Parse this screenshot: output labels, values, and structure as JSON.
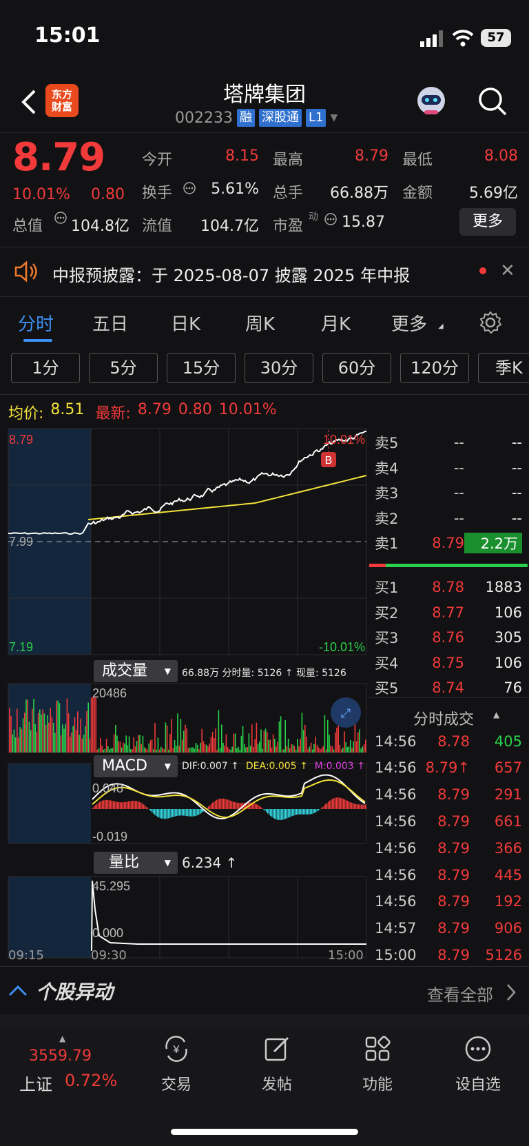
{
  "status": {
    "time": "15:01",
    "battery": "57"
  },
  "header": {
    "logo_line1": "东方",
    "logo_line2": "财富",
    "title": "塔牌集团",
    "code": "002233",
    "tags": [
      "融",
      "深股通",
      "L1"
    ]
  },
  "quote": {
    "price": "8.79",
    "change_pct": "10.01%",
    "change": "0.80",
    "open_label": "今开",
    "open": "8.15",
    "high_label": "最高",
    "high": "8.79",
    "low_label": "最低",
    "low": "8.08",
    "turnover_label": "换手",
    "turnover": "5.61%",
    "volume_label": "总手",
    "volume": "66.88万",
    "amount_label": "金额",
    "amount": "5.69亿",
    "mcap_label": "总值",
    "mcap": "104.8亿",
    "float_label": "流值",
    "float": "104.7亿",
    "pe_label": "市盈",
    "pe_sup": "动",
    "pe": "15.87",
    "more": "更多"
  },
  "notice": {
    "text": "中报预披露：于 2025-08-07 披露 2025 年中报"
  },
  "tabs": [
    "分时",
    "五日",
    "日K",
    "周K",
    "月K",
    "更多"
  ],
  "periods": [
    "1分",
    "5分",
    "15分",
    "30分",
    "60分",
    "120分",
    "季K"
  ],
  "chart_info": {
    "avg_label": "均价:",
    "avg": "8.51",
    "latest_label": "最新:",
    "latest": "8.79",
    "chg": "0.80",
    "pct": "10.01%"
  },
  "chart_data": {
    "type": "line",
    "y_top": "8.79",
    "y_mid": "7.99",
    "y_bottom": "7.19",
    "pct_top": "10.01%",
    "pct_bottom": "-10.01%",
    "x_labels": [
      "09:15",
      "09:30",
      "15:00"
    ],
    "marker": "B",
    "volume_title": "成交量",
    "volume_info": "66.88万 分时量: 5126 ↑ 现量: 5126",
    "volume_max": "20486",
    "macd_title": "MACD",
    "dif": "DIF:0.007 ↑",
    "dea": "DEA:0.005 ↑",
    "m": "M:0.003 ↑",
    "macd_top": "0.048",
    "macd_bottom": "-0.019",
    "lb_title": "量比",
    "lb_value": "6.234 ↑",
    "lb_top": "45.295",
    "lb_bottom": "0.000"
  },
  "order_book": {
    "asks": [
      {
        "label": "卖5",
        "price": "--",
        "vol": "--"
      },
      {
        "label": "卖4",
        "price": "--",
        "vol": "--"
      },
      {
        "label": "卖3",
        "price": "--",
        "vol": "--"
      },
      {
        "label": "卖2",
        "price": "--",
        "vol": "--"
      },
      {
        "label": "卖1",
        "price": "8.79",
        "vol": "2.2万"
      }
    ],
    "bids": [
      {
        "label": "买1",
        "price": "8.78",
        "vol": "1883"
      },
      {
        "label": "买2",
        "price": "8.77",
        "vol": "106"
      },
      {
        "label": "买3",
        "price": "8.76",
        "vol": "305"
      },
      {
        "label": "买4",
        "price": "8.75",
        "vol": "106"
      },
      {
        "label": "买5",
        "price": "8.74",
        "vol": "76"
      }
    ]
  },
  "ticks_title": "分时成交",
  "ticks": [
    {
      "t": "14:56",
      "p": "8.78",
      "v": "405"
    },
    {
      "t": "14:56",
      "p": "8.79↑",
      "v": "657"
    },
    {
      "t": "14:56",
      "p": "8.79",
      "v": "291"
    },
    {
      "t": "14:56",
      "p": "8.79",
      "v": "661"
    },
    {
      "t": "14:56",
      "p": "8.79",
      "v": "366"
    },
    {
      "t": "14:56",
      "p": "8.79",
      "v": "445"
    },
    {
      "t": "14:56",
      "p": "8.79",
      "v": "192"
    },
    {
      "t": "14:57",
      "p": "8.79",
      "v": "906"
    },
    {
      "t": "15:00",
      "p": "8.79",
      "v": "5126"
    }
  ],
  "alert": {
    "title": "个股异动",
    "view_all": "查看全部"
  },
  "bottom": {
    "index_value": "3559.79",
    "index_name": "上证",
    "index_pct": "0.72%",
    "nav": [
      "交易",
      "发帖",
      "功能",
      "设自选"
    ]
  }
}
